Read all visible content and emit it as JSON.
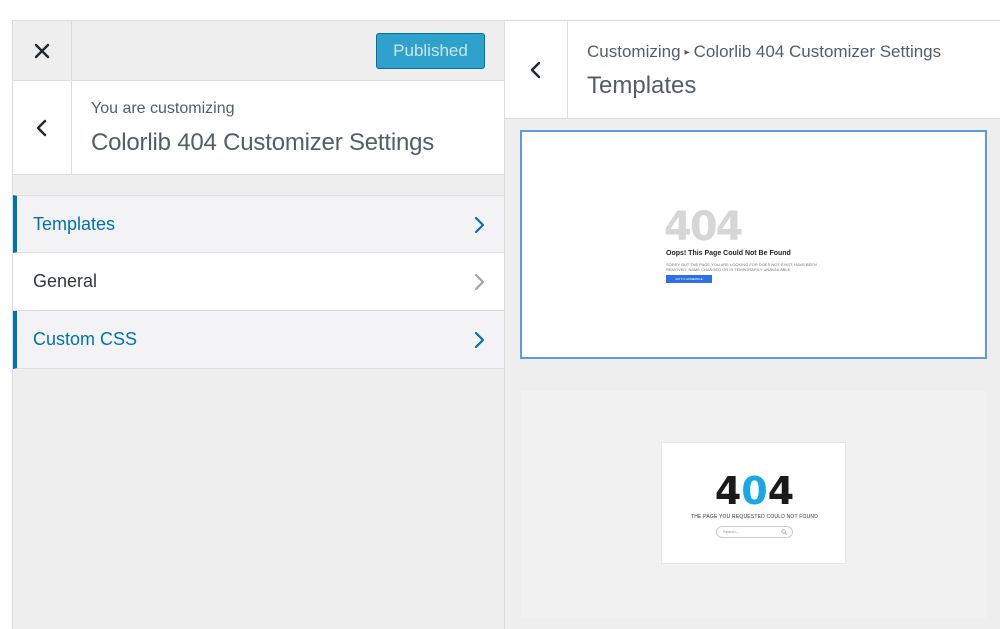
{
  "left_panel": {
    "publish_label": "Published",
    "customizing_label": "You are customizing",
    "customizing_title": "Colorlib 404 Customizer Settings",
    "menu": [
      {
        "label": "Templates",
        "state": "active"
      },
      {
        "label": "General",
        "state": "normal"
      },
      {
        "label": "Custom CSS",
        "state": "active"
      }
    ]
  },
  "right_panel": {
    "breadcrumb_parent": "Customizing",
    "breadcrumb_separator": "▸",
    "breadcrumb_current": "Colorlib 404 Customizer Settings",
    "section_title": "Templates",
    "templates": [
      {
        "big_text": "404",
        "heading": "Oops! This Page Could Not Be Found",
        "body": "SORRY BUT THE PAGE YOU ARE LOOKING FOR DOES NOT EXIST, HAVE BEEN REMOVED. NAME CHANGED OR IS TEMPORARILY UNAVAILABLE",
        "button": "GO TO HOMEPAGE",
        "selected": true
      },
      {
        "big_text_parts": [
          "4",
          "0",
          "4"
        ],
        "subtitle": "THE PAGE YOU REQUESTED COULD NOT FOUND",
        "search_placeholder": "Search...",
        "selected": false
      }
    ]
  },
  "colors": {
    "accent": "#0073aa",
    "publish_bg": "#2ea2cc",
    "selected_border": "#5b9dd9",
    "highlight_zero": "#19a8e6"
  },
  "icons": {
    "close": "close-icon",
    "back": "chevron-left-icon",
    "menu_arrow": "chevron-right-icon",
    "search": "search-icon"
  }
}
